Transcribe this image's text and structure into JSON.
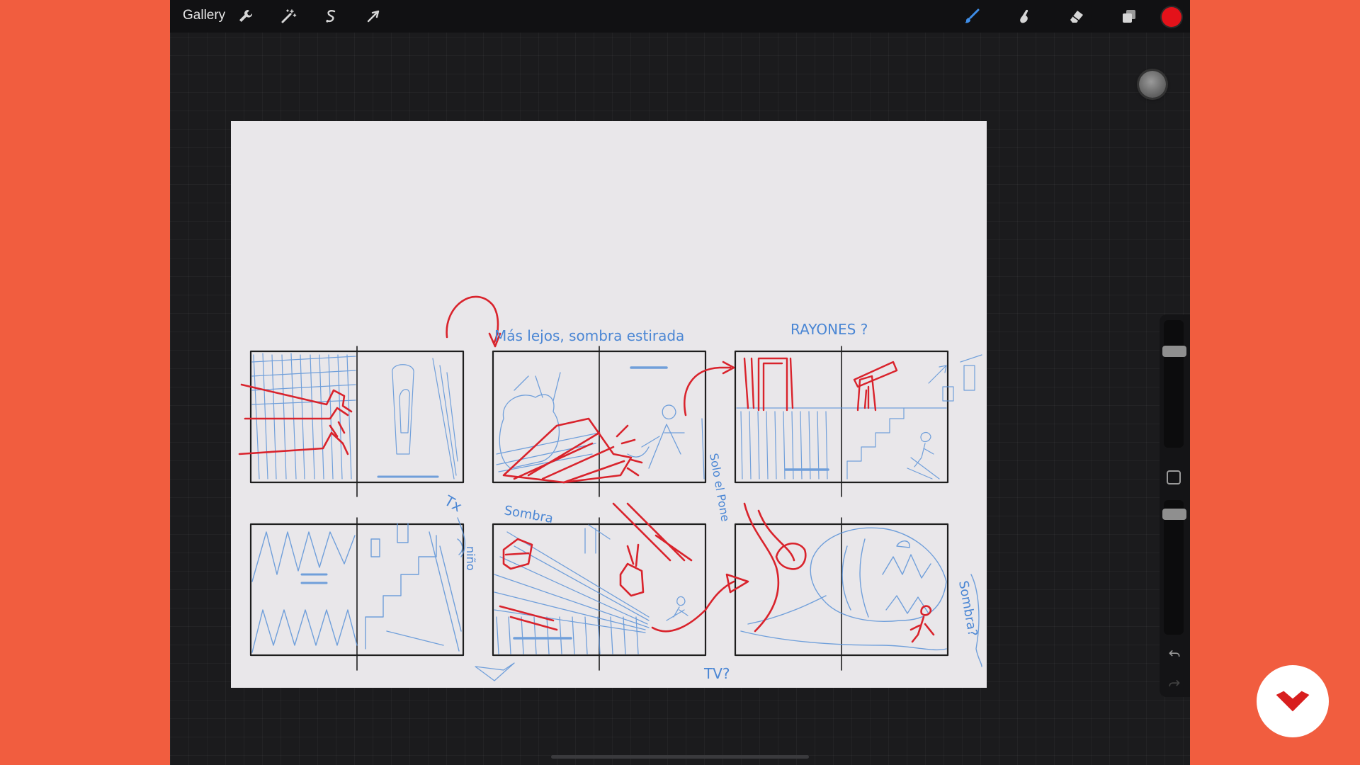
{
  "toolbar": {
    "gallery_label": "Gallery",
    "left_icons": [
      "wrench-icon",
      "magic-wand-icon",
      "selection-icon",
      "transform-arrow-icon"
    ],
    "right_icons": [
      "brush-icon",
      "smudge-icon",
      "eraser-icon",
      "layers-icon"
    ],
    "current_color": "#E3121A"
  },
  "sketch": {
    "annotations": {
      "note_far": "Más lejos, sombra estirada",
      "note_rayones": "RAYONES ?",
      "note_tx": "Tx",
      "note_solo": "Solo el Pone",
      "note_sombra_1": "Sombra",
      "note_nino": "niño",
      "note_tv": "TV?",
      "note_sombra_2": "Sombra?"
    },
    "pen_colors": {
      "blue": "#4A86D4",
      "red": "#D9232C",
      "ink": "#1E1E1E"
    }
  },
  "colors": {
    "background": "#F15D3F",
    "app_background": "#1B1B1D",
    "canvas": "#E9E7EA"
  },
  "logo": {
    "icon": "brand-logo-icon",
    "color": "#D81E1E"
  }
}
